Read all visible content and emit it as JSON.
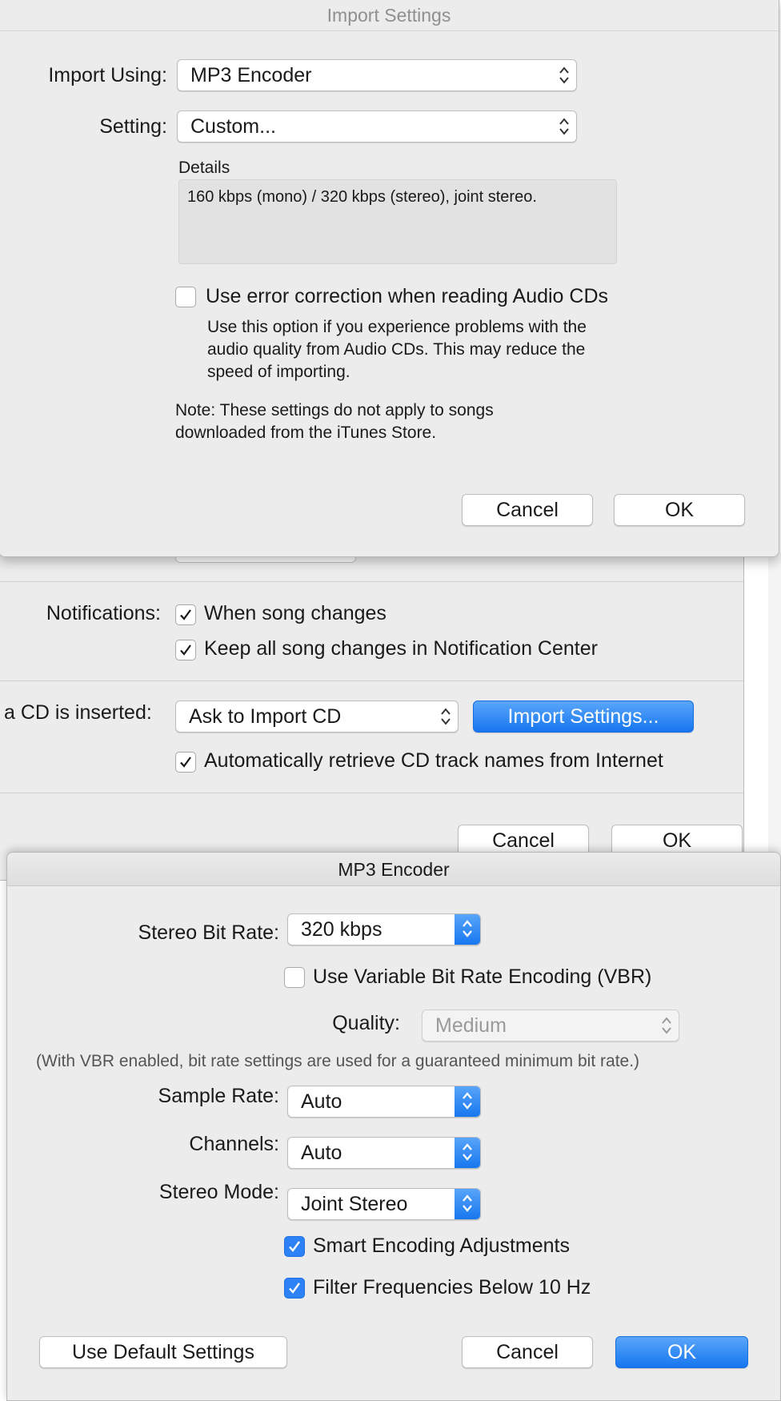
{
  "import_settings": {
    "title": "Import Settings",
    "import_using_label": "Import Using:",
    "import_using_value": "MP3 Encoder",
    "setting_label": "Setting:",
    "setting_value": "Custom...",
    "details_label": "Details",
    "details_text": "160 kbps (mono) / 320 kbps (stereo), joint stereo.",
    "error_correction_label": "Use error correction when reading Audio CDs",
    "error_correction_checked": false,
    "error_correction_help_1": "Use this option if you experience problems with the",
    "error_correction_help_2": "audio quality from Audio CDs.  This may reduce the",
    "error_correction_help_3": "speed of importing.",
    "note_1": "Note: These settings do not apply to songs",
    "note_2": "downloaded from the iTunes Store.",
    "cancel_label": "Cancel",
    "ok_label": "OK"
  },
  "general_prefs": {
    "notifications_label": "Notifications:",
    "when_song_changes_label": "When song changes",
    "when_song_changes_checked": true,
    "keep_all_label": "Keep all song changes in Notification Center",
    "keep_all_checked": true,
    "cd_inserted_label": "a CD is inserted:",
    "cd_inserted_value": "Ask to Import CD",
    "import_settings_button": "Import Settings...",
    "auto_retrieve_label": "Automatically retrieve CD track names from Internet",
    "auto_retrieve_checked": true,
    "cancel_label": "Cancel",
    "ok_label": "OK"
  },
  "mp3_encoder": {
    "title": "MP3 Encoder",
    "stereo_bit_rate_label": "Stereo Bit Rate:",
    "stereo_bit_rate_value": "320 kbps",
    "vbr_label": "Use Variable Bit Rate Encoding (VBR)",
    "vbr_checked": false,
    "quality_label": "Quality:",
    "quality_value": "Medium",
    "vbr_note": "(With VBR enabled, bit rate settings are used for a guaranteed minimum bit rate.)",
    "sample_rate_label": "Sample Rate:",
    "sample_rate_value": "Auto",
    "channels_label": "Channels:",
    "channels_value": "Auto",
    "stereo_mode_label": "Stereo Mode:",
    "stereo_mode_value": "Joint Stereo",
    "smart_encoding_label": "Smart Encoding Adjustments",
    "smart_encoding_checked": true,
    "filter_label": "Filter Frequencies Below 10 Hz",
    "filter_checked": true,
    "default_settings_label": "Use Default Settings",
    "cancel_label": "Cancel",
    "ok_label": "OK"
  },
  "colors": {
    "accent": "#1676ef",
    "window_bg": "#ececec"
  }
}
